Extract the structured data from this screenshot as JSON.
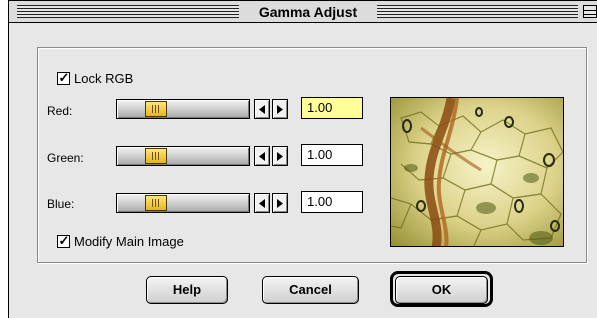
{
  "window": {
    "title": "Gamma Adjust"
  },
  "options": {
    "lock_rgb": {
      "label": "Lock RGB",
      "checked": true
    },
    "modify_main": {
      "label": "Modify Main Image",
      "checked": true
    }
  },
  "channels": [
    {
      "label": "Red:",
      "value": "1.00",
      "active": true
    },
    {
      "label": "Green:",
      "value": "1.00",
      "active": false
    },
    {
      "label": "Blue:",
      "value": "1.00",
      "active": false
    }
  ],
  "buttons": {
    "help": "Help",
    "cancel": "Cancel",
    "ok": "OK"
  },
  "colors": {
    "slider_thumb": "#e6b622",
    "active_field": "#ffff9a",
    "background": "#e7e7e7"
  },
  "icons": {
    "decrement": "left-arrow-icon",
    "increment": "right-arrow-icon",
    "zoom": "zoom-box-icon",
    "check": "checkmark-icon"
  }
}
